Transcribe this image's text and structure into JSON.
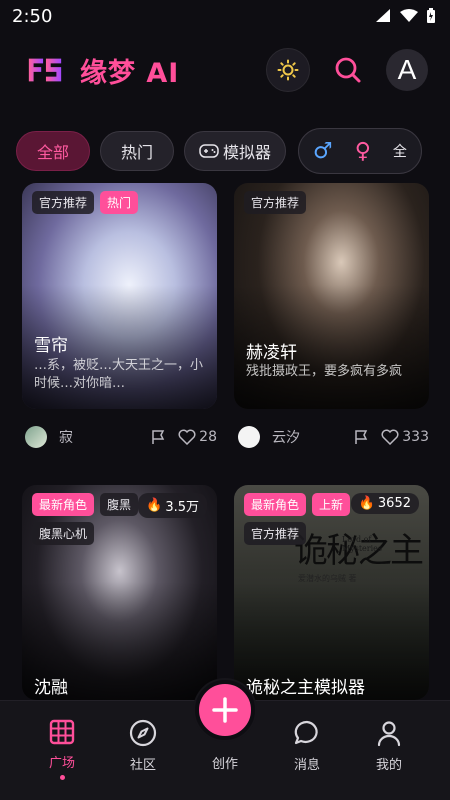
{
  "status_bar": {
    "time": "2:50"
  },
  "header": {
    "app_title": "缘梦 AI",
    "avatar_letter": "A"
  },
  "filters": {
    "chips": [
      "全部",
      "热门",
      "模拟器"
    ],
    "gender": {
      "male": "♂",
      "female": "♀",
      "all": "全"
    }
  },
  "cards": [
    {
      "tags": [
        "官方推荐",
        "热门"
      ],
      "name": "雪帘",
      "desc": "…系，被贬…大天王之一，小时候…对你暗…",
      "author": "寂",
      "likes": "28"
    },
    {
      "tags": [
        "官方推荐"
      ],
      "name": "赫凌轩",
      "desc": "残批摄政王，要多疯有多疯",
      "author": "云汐",
      "likes": "333"
    },
    {
      "tags": [
        "最新角色",
        "腹黑",
        "腹黑心机"
      ],
      "heat": "3.5万",
      "name": "沈融"
    },
    {
      "tags": [
        "最新角色",
        "上新",
        "官方推荐"
      ],
      "heat": "3652",
      "name": "诡秘之主模拟器",
      "poster_title": "诡秘之主",
      "poster_sub": "Lord of Mysteries",
      "poster_author": "爱潜水的乌贼 著"
    }
  ],
  "bottom_nav": [
    {
      "label": "广场"
    },
    {
      "label": "社区"
    },
    {
      "label": "创作"
    },
    {
      "label": "消息"
    },
    {
      "label": "我的"
    }
  ],
  "colors": {
    "accent": "#ff4f9a",
    "background": "#0e0d12"
  }
}
